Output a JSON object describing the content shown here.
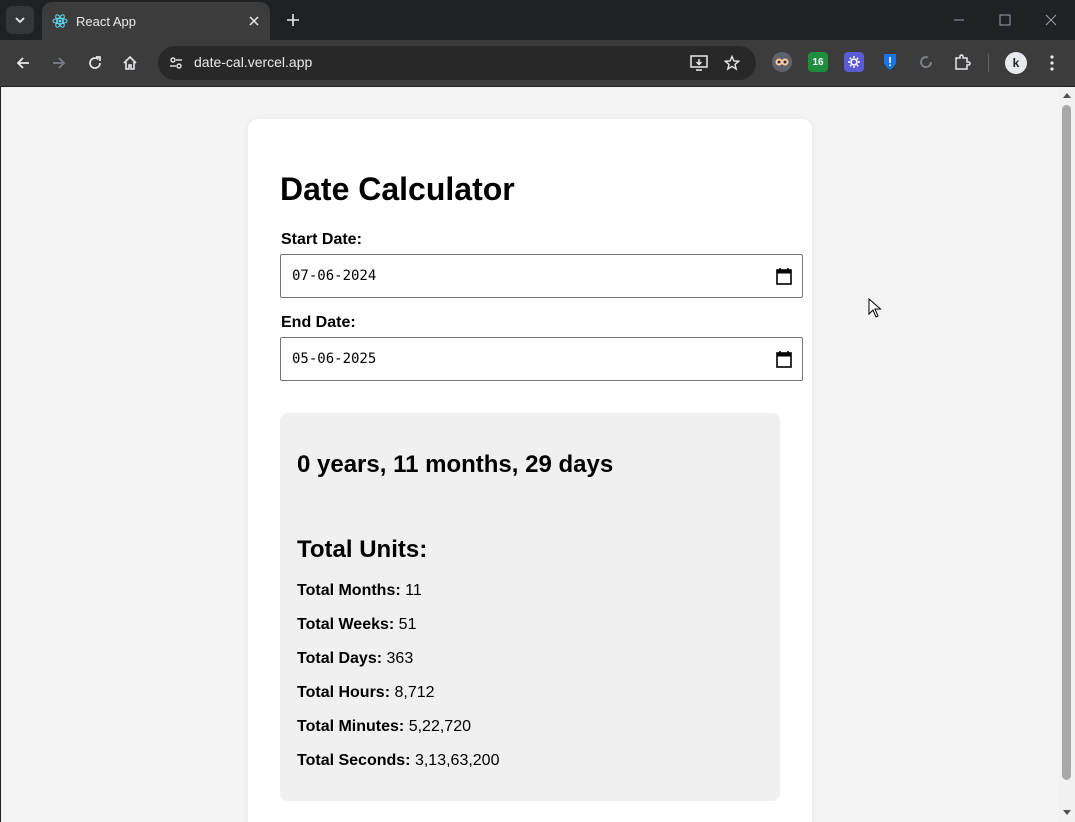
{
  "browser": {
    "tab_title": "React App",
    "url": "date-cal.vercel.app",
    "extension_badge": "16",
    "profile_initial": "k"
  },
  "page": {
    "heading": "Date Calculator",
    "start_label": "Start Date:",
    "start_value": "07-06-2024",
    "end_label": "End Date:",
    "end_value": "05-06-2025",
    "duration": "0 years, 11 months, 29 days",
    "units_heading": "Total Units:",
    "units": [
      {
        "label": "Total Months:",
        "value": "11"
      },
      {
        "label": "Total Weeks:",
        "value": "51"
      },
      {
        "label": "Total Days:",
        "value": "363"
      },
      {
        "label": "Total Hours:",
        "value": "8,712"
      },
      {
        "label": "Total Minutes:",
        "value": "5,22,720"
      },
      {
        "label": "Total Seconds:",
        "value": "3,13,63,200"
      }
    ]
  },
  "colors": {
    "page_bg": "#f4f4f4",
    "card_bg": "#ffffff",
    "result_bg": "#f0f0f0",
    "react_blue": "#61dafb"
  }
}
